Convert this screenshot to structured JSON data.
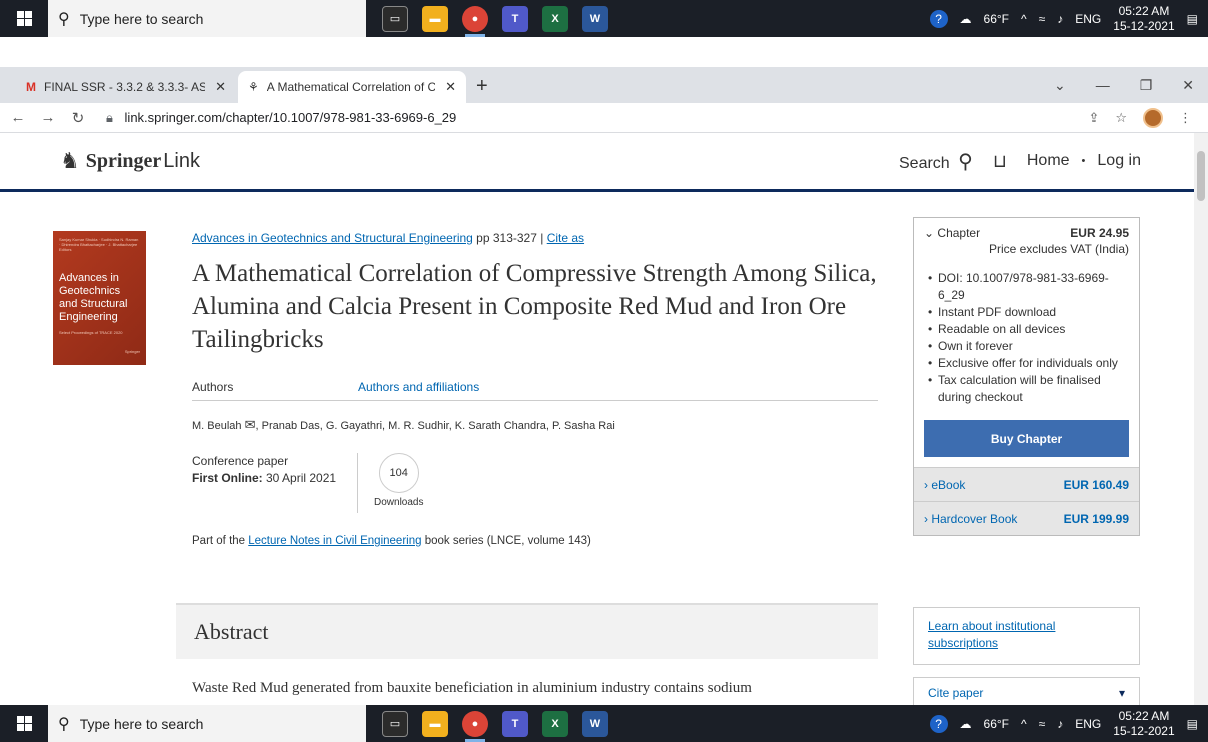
{
  "taskbar": {
    "search_placeholder": "Type here to search",
    "weather": "66°F",
    "lang": "ENG",
    "time": "05:22 AM",
    "date": "15-12-2021",
    "notif_count": "1"
  },
  "tabs": [
    {
      "label": "FINAL SSR - 3.3.2 & 3.3.3- AS ON",
      "icon": "gmail-icon"
    },
    {
      "label": "A Mathematical Correlation of C",
      "icon": "springer-icon"
    }
  ],
  "address": {
    "url": "link.springer.com/chapter/10.1007/978-981-33-6969-6_29"
  },
  "header": {
    "brand_bold": "Springer",
    "brand_light": "Link",
    "search_label": "Search",
    "home": "Home",
    "separator": "•",
    "login": "Log in"
  },
  "book": {
    "cover_small": "Sanjay Kumar Shukla · Sudhindra N. Raman · Dhirendra Bhattacharjee · J. Bhattacharjee Editors",
    "cover_title": "Advances in Geotechnics and Structural Engineering",
    "cover_sub": "Select Proceedings of TRACE 2020",
    "cover_publisher": "Springer"
  },
  "article": {
    "book_link": "Advances in Geotechnics and Structural Engineering",
    "pages": " pp 313-327 | ",
    "cite_as": "Cite as",
    "title": "A Mathematical Correlation of Compressive Strength Among Silica, Alumina and Calcia Present in Composite Red Mud and Iron Ore Tailingbricks",
    "tab_authors": "Authors",
    "tab_affiliations": "Authors and affiliations",
    "author_first": "M. Beulah",
    "authors_rest": ", Pranab Das, G. Gayathri, M. R. Sudhir, K. Sarath Chandra, P. Sasha Rai",
    "type": "Conference paper",
    "first_online_label": "First Online:",
    "first_online": " 30 April 2021",
    "downloads_count": "104",
    "downloads_label": "Downloads",
    "part_of_pre": "Part of the ",
    "series_link": "Lecture Notes in Civil Engineering",
    "part_of_post": " book series (LNCE, volume 143)",
    "abstract_heading": "Abstract",
    "abstract_text": "Waste Red Mud generated from bauxite beneficiation in aluminium industry contains sodium"
  },
  "buybox": {
    "chapter_label": "Chapter",
    "chapter_price": "EUR  24.95",
    "vat": "Price excludes VAT (India)",
    "features": [
      "DOI: 10.1007/978-981-33-6969-6_29",
      "Instant PDF download",
      "Readable on all devices",
      "Own it forever",
      "Exclusive offer for individuals only",
      "Tax calculation will be finalised during checkout"
    ],
    "buy_button": "Buy Chapter",
    "ebook_label": "eBook",
    "ebook_price": "EUR  160.49",
    "hardcover_label": "Hardcover Book",
    "hardcover_price": "EUR  199.99"
  },
  "sidebar": {
    "institutional": "Learn about institutional subscriptions",
    "cite_paper": "Cite paper"
  },
  "colors": {
    "springer_blue": "#0066b1",
    "buy_button": "#3d6db0",
    "header_rule": "#0d2a5c"
  }
}
